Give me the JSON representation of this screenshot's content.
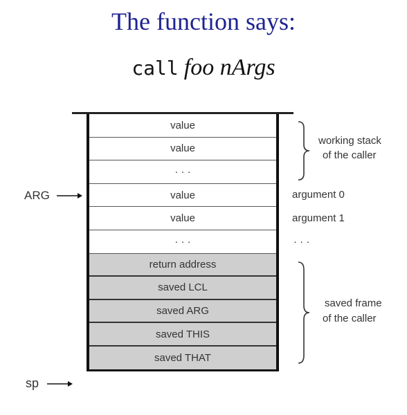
{
  "title": "The function says:",
  "subtitle": {
    "code": "call",
    "italic": "foo nArgs"
  },
  "stack": [
    {
      "label": "value",
      "type": "working"
    },
    {
      "label": "value",
      "type": "working"
    },
    {
      "label": "· · ·",
      "type": "working"
    },
    {
      "label": "value",
      "type": "working"
    },
    {
      "label": "value",
      "type": "working"
    },
    {
      "label": "· · ·",
      "type": "working"
    },
    {
      "label": "return address",
      "type": "frame"
    },
    {
      "label": "saved LCL",
      "type": "frame"
    },
    {
      "label": "saved ARG",
      "type": "frame"
    },
    {
      "label": "saved THIS",
      "type": "frame"
    },
    {
      "label": "saved THAT",
      "type": "frame"
    }
  ],
  "pointers": {
    "arg": "ARG",
    "sp": "sp"
  },
  "annotations": {
    "working_stack": [
      "working stack",
      "of the caller"
    ],
    "argument0": "argument 0",
    "argument1": "argument 1",
    "ellipsis": "· · ·",
    "saved_frame": [
      "saved frame",
      "of the caller"
    ]
  },
  "colors": {
    "title": "#1e2390",
    "frame_fill": "#cfcfcf"
  }
}
